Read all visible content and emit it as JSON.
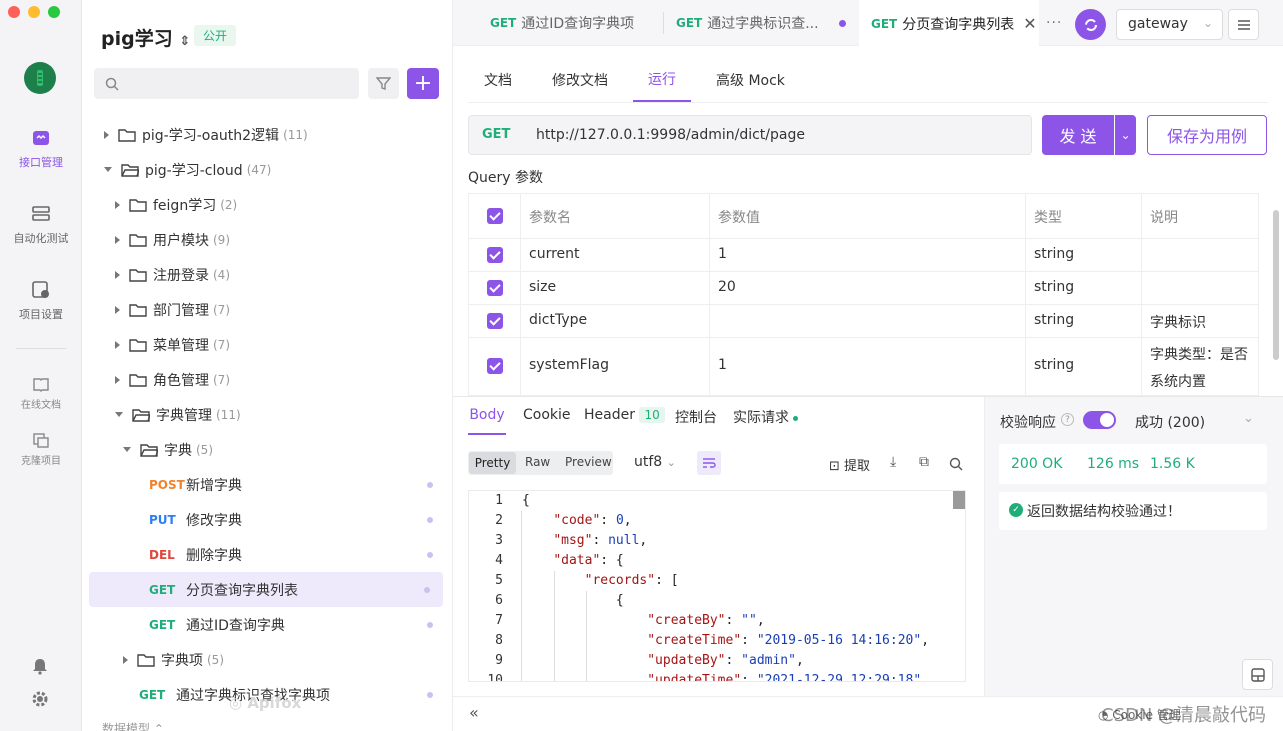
{
  "colors": {
    "accent": "#8c55e8",
    "get": "#1fae7a",
    "post": "#f0832d",
    "put": "#2c7ff0",
    "del": "#e0473a"
  },
  "rail": {
    "items": [
      {
        "label": "接口管理",
        "icon": "api-icon"
      },
      {
        "label": "自动化测试",
        "icon": "test-icon"
      },
      {
        "label": "项目设置",
        "icon": "settings-doc-icon"
      },
      {
        "label": "在线文档",
        "icon": "book-icon"
      },
      {
        "label": "克隆项目",
        "icon": "clone-icon"
      }
    ]
  },
  "sidebar": {
    "project_name": "pig学习",
    "visibility_badge": "公开",
    "search_placeholder": "",
    "tree": [
      {
        "label": "pig-学习-oauth2逻辑",
        "count": "(11)"
      },
      {
        "label": "pig-学习-cloud",
        "count": "(47)"
      },
      {
        "label": "feign学习",
        "count": "(2)"
      },
      {
        "label": "用户模块",
        "count": "(9)"
      },
      {
        "label": "注册登录",
        "count": "(4)"
      },
      {
        "label": "部门管理",
        "count": "(7)"
      },
      {
        "label": "菜单管理",
        "count": "(7)"
      },
      {
        "label": "角色管理",
        "count": "(7)"
      },
      {
        "label": "字典管理",
        "count": "(11)"
      },
      {
        "label": "字典",
        "count": "(5)"
      },
      {
        "method": "POST",
        "label": "新增字典"
      },
      {
        "method": "PUT",
        "label": "修改字典"
      },
      {
        "method": "DEL",
        "label": "删除字典"
      },
      {
        "method": "GET",
        "label": "分页查询字典列表"
      },
      {
        "method": "GET",
        "label": "通过ID查询字典"
      },
      {
        "label": "字典项",
        "count": "(5)"
      },
      {
        "method": "GET",
        "label": "通过字典标识查找字典项"
      },
      {
        "label": "数据模型"
      }
    ],
    "watermark": "Apifox"
  },
  "tabs": [
    {
      "method": "GET",
      "label": "通过ID查询字典项"
    },
    {
      "method": "GET",
      "label": "通过字典标识查..."
    },
    {
      "method": "GET",
      "label": "分页查询字典列表"
    }
  ],
  "env": {
    "selected": "gateway"
  },
  "subtabs": [
    "文档",
    "修改文档",
    "运行",
    "高级 Mock"
  ],
  "request": {
    "method": "GET",
    "url": "http://127.0.0.1:9998/admin/dict/page",
    "send_label": "发 送",
    "save_label": "保存为用例"
  },
  "query": {
    "section_title": "Query 参数",
    "headers": [
      "参数名",
      "参数值",
      "类型",
      "说明"
    ],
    "rows": [
      {
        "name": "current",
        "value": "1",
        "type": "string",
        "desc": ""
      },
      {
        "name": "size",
        "value": "20",
        "type": "string",
        "desc": ""
      },
      {
        "name": "dictType",
        "value": "",
        "type": "string",
        "desc": "字典标识"
      },
      {
        "name": "systemFlag",
        "value": "1",
        "type": "string",
        "desc": "字典类型：是否",
        "desc2": "系统内置"
      }
    ]
  },
  "response": {
    "tabs": [
      "Body",
      "Cookie",
      "Header",
      "控制台",
      "实际请求"
    ],
    "header_count": "10",
    "formats": [
      "Pretty",
      "Raw",
      "Preview"
    ],
    "encoding": "utf8",
    "extract_label": "提取",
    "lines": [
      "1",
      "2",
      "3",
      "4",
      "5",
      "6",
      "7",
      "8",
      "9",
      "10"
    ]
  },
  "validation": {
    "label": "校验响应",
    "result": "成功 (200)",
    "status": "200 OK",
    "time": "126 ms",
    "size": "1.56 K",
    "message": "返回数据结构校验通过！"
  },
  "footer": {
    "csdn": "CSDN @清晨敲代码",
    "cookie_label": "Cookie 管理"
  }
}
